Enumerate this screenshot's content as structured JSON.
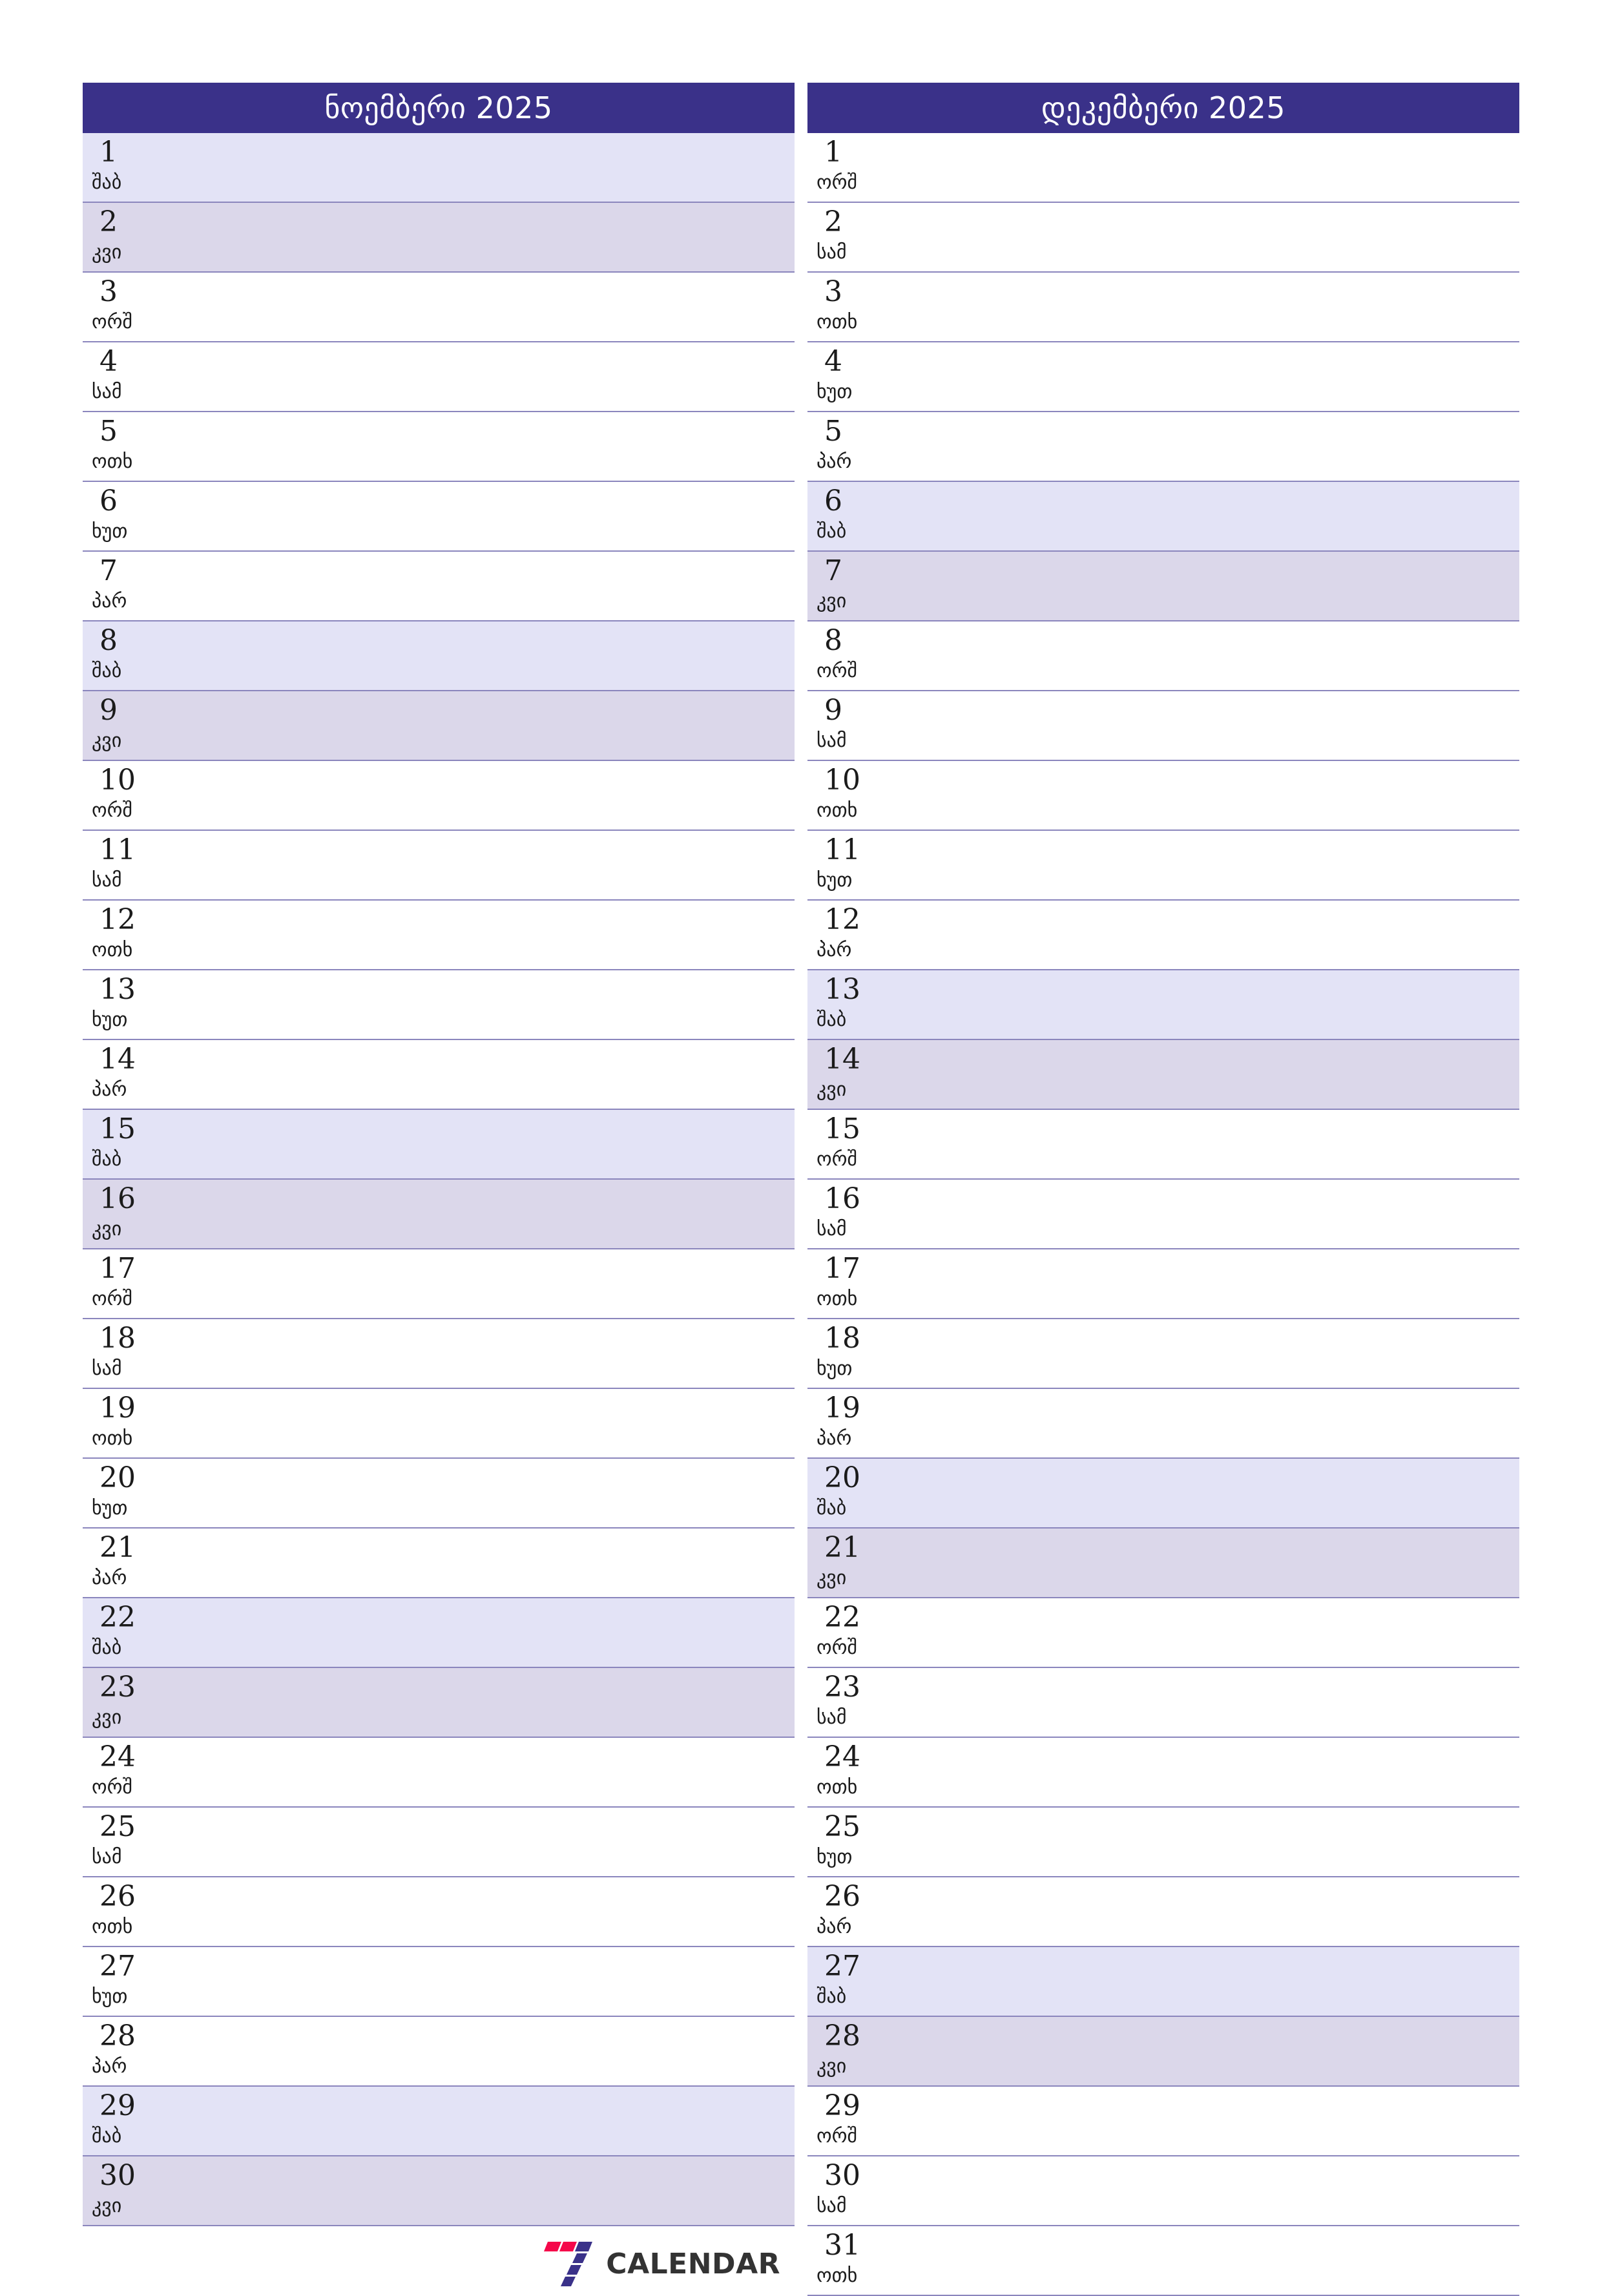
{
  "colors": {
    "header_bg": "#3a3189",
    "header_text": "#ffffff",
    "saturday_bg": "#e3e3f6",
    "sunday_bg": "#dbd7ea",
    "row_line": "#8b86bd",
    "day_text": "#1b1b1b",
    "brand_text": "#333333",
    "brand_accent_red": "#f5084a",
    "brand_accent_purple": "#3a3189"
  },
  "brand": {
    "name": "CALENDAR",
    "mark": "seven-logo-icon"
  },
  "months": [
    {
      "title": "ნოემბერი 2025",
      "name": "ნოემბერი",
      "year": "2025",
      "days": [
        {
          "num": "1",
          "wd": "შაბ",
          "type": "sat"
        },
        {
          "num": "2",
          "wd": "კვი",
          "type": "sun"
        },
        {
          "num": "3",
          "wd": "ორშ",
          "type": "weekday"
        },
        {
          "num": "4",
          "wd": "სამ",
          "type": "weekday"
        },
        {
          "num": "5",
          "wd": "ოთხ",
          "type": "weekday"
        },
        {
          "num": "6",
          "wd": "ხუთ",
          "type": "weekday"
        },
        {
          "num": "7",
          "wd": "პარ",
          "type": "weekday"
        },
        {
          "num": "8",
          "wd": "შაბ",
          "type": "sat"
        },
        {
          "num": "9",
          "wd": "კვი",
          "type": "sun"
        },
        {
          "num": "10",
          "wd": "ორშ",
          "type": "weekday"
        },
        {
          "num": "11",
          "wd": "სამ",
          "type": "weekday"
        },
        {
          "num": "12",
          "wd": "ოთხ",
          "type": "weekday"
        },
        {
          "num": "13",
          "wd": "ხუთ",
          "type": "weekday"
        },
        {
          "num": "14",
          "wd": "პარ",
          "type": "weekday"
        },
        {
          "num": "15",
          "wd": "შაბ",
          "type": "sat"
        },
        {
          "num": "16",
          "wd": "კვი",
          "type": "sun"
        },
        {
          "num": "17",
          "wd": "ორშ",
          "type": "weekday"
        },
        {
          "num": "18",
          "wd": "სამ",
          "type": "weekday"
        },
        {
          "num": "19",
          "wd": "ოთხ",
          "type": "weekday"
        },
        {
          "num": "20",
          "wd": "ხუთ",
          "type": "weekday"
        },
        {
          "num": "21",
          "wd": "პარ",
          "type": "weekday"
        },
        {
          "num": "22",
          "wd": "შაბ",
          "type": "sat"
        },
        {
          "num": "23",
          "wd": "კვი",
          "type": "sun"
        },
        {
          "num": "24",
          "wd": "ორშ",
          "type": "weekday"
        },
        {
          "num": "25",
          "wd": "სამ",
          "type": "weekday"
        },
        {
          "num": "26",
          "wd": "ოთხ",
          "type": "weekday"
        },
        {
          "num": "27",
          "wd": "ხუთ",
          "type": "weekday"
        },
        {
          "num": "28",
          "wd": "პარ",
          "type": "weekday"
        },
        {
          "num": "29",
          "wd": "შაბ",
          "type": "sat"
        },
        {
          "num": "30",
          "wd": "კვი",
          "type": "sun"
        }
      ]
    },
    {
      "title": "დეკემბერი 2025",
      "name": "დეკემბერი",
      "year": "2025",
      "days": [
        {
          "num": "1",
          "wd": "ორშ",
          "type": "weekday"
        },
        {
          "num": "2",
          "wd": "სამ",
          "type": "weekday"
        },
        {
          "num": "3",
          "wd": "ოთხ",
          "type": "weekday"
        },
        {
          "num": "4",
          "wd": "ხუთ",
          "type": "weekday"
        },
        {
          "num": "5",
          "wd": "პარ",
          "type": "weekday"
        },
        {
          "num": "6",
          "wd": "შაბ",
          "type": "sat"
        },
        {
          "num": "7",
          "wd": "კვი",
          "type": "sun"
        },
        {
          "num": "8",
          "wd": "ორშ",
          "type": "weekday"
        },
        {
          "num": "9",
          "wd": "სამ",
          "type": "weekday"
        },
        {
          "num": "10",
          "wd": "ოთხ",
          "type": "weekday"
        },
        {
          "num": "11",
          "wd": "ხუთ",
          "type": "weekday"
        },
        {
          "num": "12",
          "wd": "პარ",
          "type": "weekday"
        },
        {
          "num": "13",
          "wd": "შაბ",
          "type": "sat"
        },
        {
          "num": "14",
          "wd": "კვი",
          "type": "sun"
        },
        {
          "num": "15",
          "wd": "ორშ",
          "type": "weekday"
        },
        {
          "num": "16",
          "wd": "სამ",
          "type": "weekday"
        },
        {
          "num": "17",
          "wd": "ოთხ",
          "type": "weekday"
        },
        {
          "num": "18",
          "wd": "ხუთ",
          "type": "weekday"
        },
        {
          "num": "19",
          "wd": "პარ",
          "type": "weekday"
        },
        {
          "num": "20",
          "wd": "შაბ",
          "type": "sat"
        },
        {
          "num": "21",
          "wd": "კვი",
          "type": "sun"
        },
        {
          "num": "22",
          "wd": "ორშ",
          "type": "weekday"
        },
        {
          "num": "23",
          "wd": "სამ",
          "type": "weekday"
        },
        {
          "num": "24",
          "wd": "ოთხ",
          "type": "weekday"
        },
        {
          "num": "25",
          "wd": "ხუთ",
          "type": "weekday"
        },
        {
          "num": "26",
          "wd": "პარ",
          "type": "weekday"
        },
        {
          "num": "27",
          "wd": "შაბ",
          "type": "sat"
        },
        {
          "num": "28",
          "wd": "კვი",
          "type": "sun"
        },
        {
          "num": "29",
          "wd": "ორშ",
          "type": "weekday"
        },
        {
          "num": "30",
          "wd": "სამ",
          "type": "weekday"
        },
        {
          "num": "31",
          "wd": "ოთხ",
          "type": "weekday"
        }
      ]
    }
  ]
}
